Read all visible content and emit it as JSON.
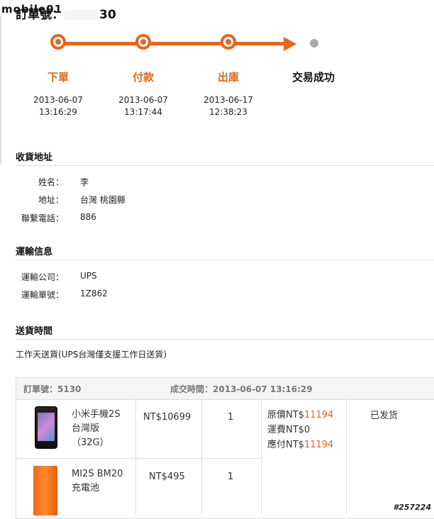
{
  "watermark": {
    "logo": "mobile01",
    "number": "#257224"
  },
  "order": {
    "title_prefix": "訂單號：",
    "title_suffix": "30"
  },
  "progress": {
    "steps": [
      {
        "label": "下單",
        "date": "2013-06-07",
        "time": "13:16:29"
      },
      {
        "label": "付款",
        "date": "2013-06-07",
        "time": "13:17:44"
      },
      {
        "label": "出庫",
        "date": "2013-06-17",
        "time": "12:38:23"
      },
      {
        "label": "交易成功"
      }
    ]
  },
  "address": {
    "heading": "收貨地址",
    "name_label": "姓名：",
    "name_value": "李",
    "addr_label": "地址：",
    "addr_value": "台灣 桃園縣",
    "phone_label": "聯繫電話：",
    "phone_value": "886"
  },
  "shipping": {
    "heading": "運輸信息",
    "company_label": "運輸公司：",
    "company_value": "UPS",
    "number_label": "運輸單號：",
    "number_value": "1Z862"
  },
  "delivery": {
    "heading": "送貨時間",
    "text": "工作天送貨(UPS台灣僅支援工作日送貨)"
  },
  "table": {
    "order_no_label": "訂單號：5130",
    "deal_time": "成交時間：2013-06-07 13:16:29",
    "items": [
      {
        "name_line1": "小米手機2S",
        "name_line2": "台灣版",
        "name_line3": "（32G）",
        "price": "NT$10699",
        "qty": "1"
      },
      {
        "name_line1": "MI2S BM20",
        "name_line2": "充電池",
        "price": "NT$495",
        "qty": "1"
      }
    ],
    "summary": {
      "original_label": "原價NT$",
      "original_value": "11194",
      "shipping_line": "運費NT$0",
      "due_label": "應付NT$",
      "due_value": "11194"
    },
    "status": "已发货"
  },
  "colors": {
    "accent": "#e8651c",
    "done_dot": "#aaaaaa"
  }
}
